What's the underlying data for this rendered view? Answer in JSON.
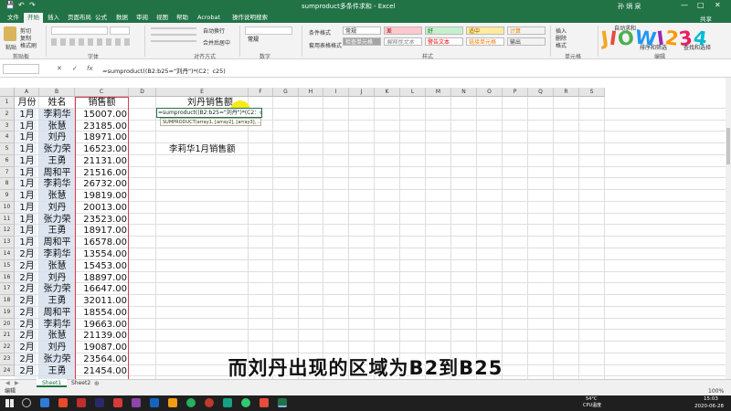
{
  "titlebar": {
    "title": "sumproduct多条件求和 - Excel",
    "user": "孙 炳 泉",
    "save_icon": "💾",
    "undo_icon": "↶",
    "redo_icon": "↷",
    "min": "—",
    "max": "□",
    "close": "✕"
  },
  "tabs": [
    "文件",
    "开始",
    "插入",
    "页面布局",
    "公式",
    "数据",
    "审阅",
    "视图",
    "帮助",
    "Acrobat",
    "操作说明搜索"
  ],
  "active_tab": "开始",
  "share_label": "共享",
  "ribbon": {
    "paste": "粘贴",
    "cut": "剪切",
    "copy": "复制",
    "format_painter": "格式刷",
    "clipboard_group": "剪贴板",
    "font_group": "字体",
    "align_group": "对齐方式",
    "number_group": "数字",
    "styles_group": "样式",
    "cells_group": "单元格",
    "edit_group": "编辑",
    "wrap_text": "自动换行",
    "merge_center": "合并后居中",
    "number_format": "常规",
    "cond_format": "条件格式",
    "table_format": "套用表格格式",
    "style_normal": "常规",
    "style_bad": "差",
    "style_good": "好",
    "style_neutral": "适中",
    "style_calc": "计算",
    "style_check": "检查单元格",
    "style_explain": "解释性文本",
    "style_warn": "警告文本",
    "style_link": "链接单元格",
    "style_output": "输出",
    "insert": "插入",
    "delete": "删除",
    "format": "格式",
    "autosum": "自动求和",
    "fill": "填充",
    "clear": "清除",
    "sort_filter": "排序和筛选",
    "find_select": "查找和选择"
  },
  "formula_bar": {
    "cancel": "✕",
    "enter": "✓",
    "fx": "fx",
    "formula": "=sumproduct((B2:b25=\"刘丹\")*(C2：c25)"
  },
  "columns": [
    "A",
    "B",
    "C",
    "D",
    "E",
    "F",
    "G",
    "H",
    "I",
    "J",
    "K",
    "L",
    "M",
    "N",
    "O",
    "P",
    "Q",
    "R",
    "S"
  ],
  "rows": [
    "1",
    "2",
    "3",
    "4",
    "5",
    "6",
    "7",
    "8",
    "9",
    "10",
    "11",
    "12",
    "13",
    "14",
    "15",
    "16",
    "17",
    "18",
    "19",
    "20",
    "21",
    "22",
    "23",
    "24"
  ],
  "headers": {
    "month": "月份",
    "name": "姓名",
    "sales": "销售额",
    "e1": "刘丹销售额"
  },
  "table": [
    [
      "1月",
      "李莉华",
      "15007.00"
    ],
    [
      "1月",
      "张慧",
      "23185.00"
    ],
    [
      "1月",
      "刘丹",
      "18971.00"
    ],
    [
      "1月",
      "张力荣",
      "16523.00"
    ],
    [
      "1月",
      "王勇",
      "21131.00"
    ],
    [
      "1月",
      "周和平",
      "21516.00"
    ],
    [
      "1月",
      "李莉华",
      "26732.00"
    ],
    [
      "1月",
      "张慧",
      "19819.00"
    ],
    [
      "1月",
      "刘丹",
      "20013.00"
    ],
    [
      "1月",
      "张力荣",
      "23523.00"
    ],
    [
      "1月",
      "王勇",
      "18917.00"
    ],
    [
      "1月",
      "周和平",
      "16578.00"
    ],
    [
      "2月",
      "李莉华",
      "13554.00"
    ],
    [
      "2月",
      "张慧",
      "15453.00"
    ],
    [
      "2月",
      "刘丹",
      "18897.00"
    ],
    [
      "2月",
      "张力荣",
      "16647.00"
    ],
    [
      "2月",
      "王勇",
      "32011.00"
    ],
    [
      "2月",
      "周和平",
      "18554.00"
    ],
    [
      "2月",
      "李莉华",
      "19663.00"
    ],
    [
      "2月",
      "张慧",
      "21139.00"
    ],
    [
      "2月",
      "刘丹",
      "19087.00"
    ],
    [
      "2月",
      "张力荣",
      "23564.00"
    ],
    [
      "2月",
      "王勇",
      "21454.00"
    ]
  ],
  "editing_cell": "=sumproduct((B2:b25=\"刘丹\")*(C2：c25",
  "tooltip": "SUMPRODUCT(array1, [array2], [array3], ...)",
  "e5_text": "李莉华1月销售额",
  "sheets": [
    "Sheet1",
    "Sheet2"
  ],
  "status": {
    "mode": "编辑",
    "zoom": "100%"
  },
  "subtitle": "而刘丹出现的区域为B2到B25",
  "watermark": [
    "J",
    "I",
    "O",
    "W",
    "I",
    "2",
    "3",
    "4"
  ],
  "watermark_colors": [
    "#f5a623",
    "#e94b3c",
    "#4caf50",
    "#2196f3",
    "#9c27b0",
    "#ff9800",
    "#e91e63",
    "#00bcd4"
  ],
  "taskbar": {
    "temp": "54°C",
    "temp_label": "CPU温度",
    "time": "15:03",
    "date": "2020-06-28"
  }
}
